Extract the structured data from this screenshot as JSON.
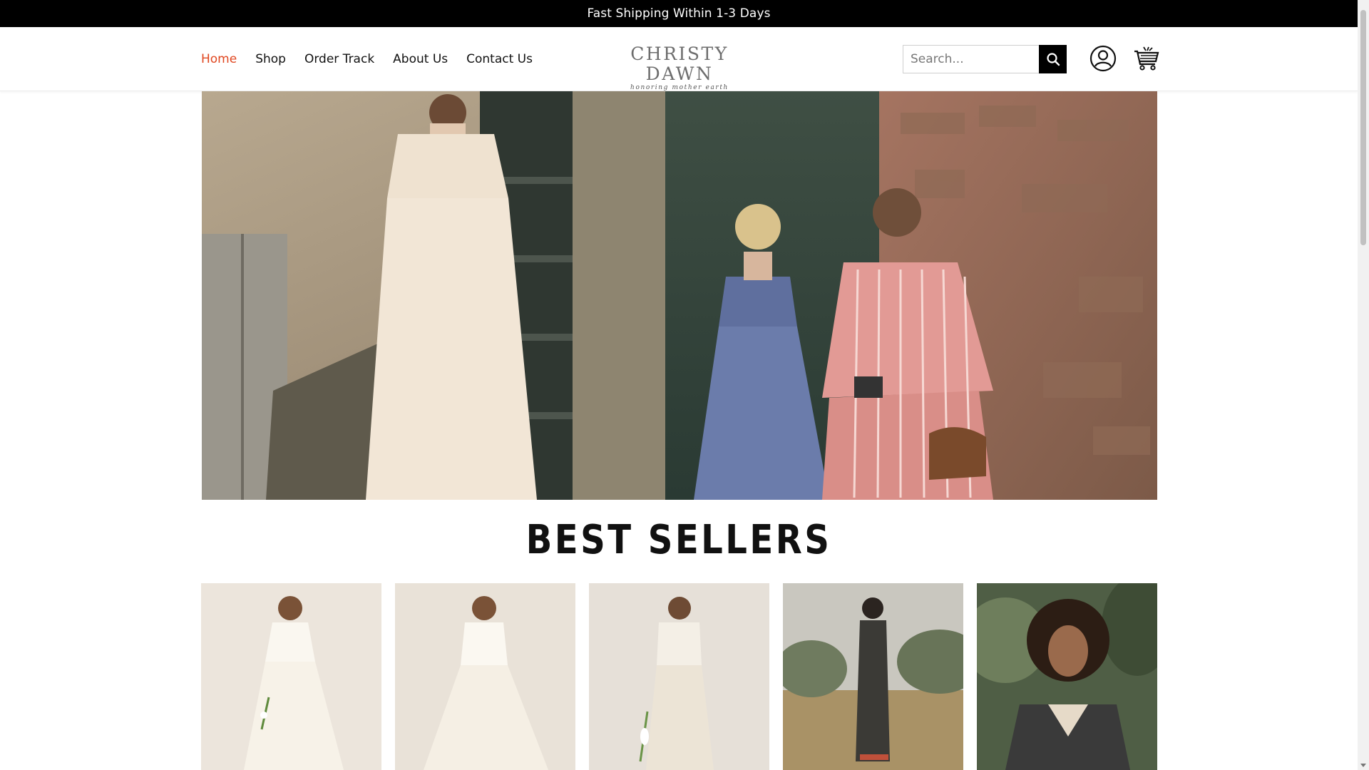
{
  "announcement": {
    "text": "Fast Shipping Within 1-3 Days"
  },
  "nav": {
    "items": [
      {
        "label": "Home",
        "active": true
      },
      {
        "label": "Shop"
      },
      {
        "label": "Order Track"
      },
      {
        "label": "About Us"
      },
      {
        "label": "Contact Us"
      }
    ]
  },
  "logo": {
    "name": "CHRISTY DAWN",
    "tagline": "honoring mother earth"
  },
  "search": {
    "placeholder": "Search..."
  },
  "icons": {
    "search": "search-icon",
    "account": "user-icon",
    "cart": "cart-icon"
  },
  "colors": {
    "accent": "#e0461f",
    "topbar": "#000000"
  },
  "best_sellers": {
    "title": "BEST SELLERS"
  }
}
